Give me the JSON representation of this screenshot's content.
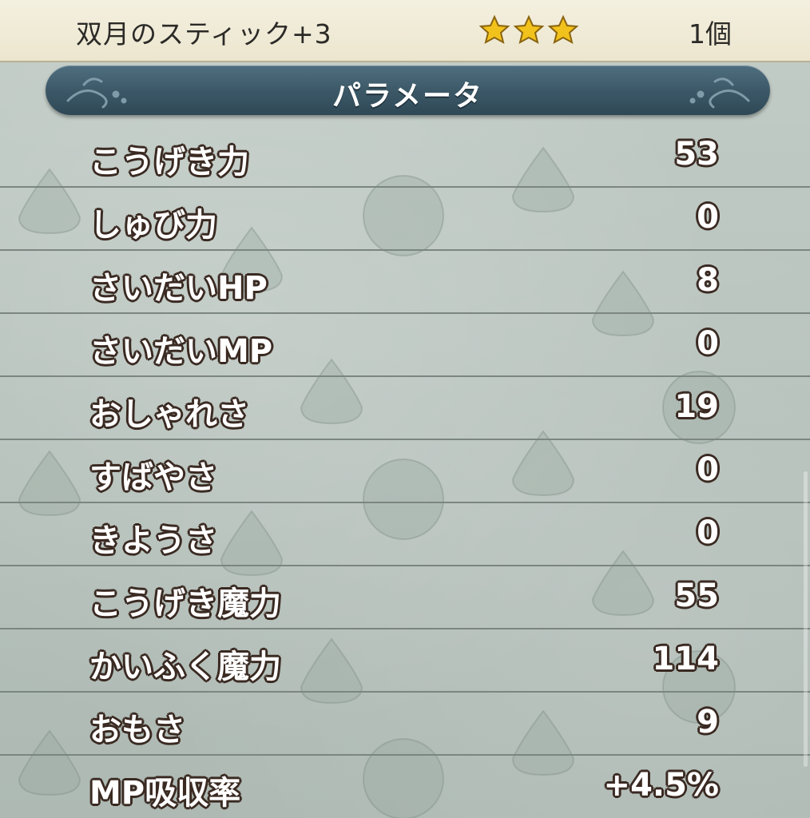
{
  "item": {
    "name": "双月のスティック+3",
    "stars": 3,
    "star_color": "#f2c21c",
    "quantity": "1個"
  },
  "section": {
    "title": "パラメータ",
    "banner_color": "#3b5766"
  },
  "parameters": [
    {
      "label": "こうげき力",
      "value": "53"
    },
    {
      "label": "しゅび力",
      "value": "0"
    },
    {
      "label": "さいだいHP",
      "value": "8"
    },
    {
      "label": "さいだいMP",
      "value": "0"
    },
    {
      "label": "おしゃれさ",
      "value": "19"
    },
    {
      "label": "すばやさ",
      "value": "0"
    },
    {
      "label": "きようさ",
      "value": "0"
    },
    {
      "label": "こうげき魔力",
      "value": "55"
    },
    {
      "label": "かいふく魔力",
      "value": "114"
    },
    {
      "label": "おもさ",
      "value": "9"
    },
    {
      "label": "MP吸収率",
      "value": "+4.5%"
    }
  ]
}
